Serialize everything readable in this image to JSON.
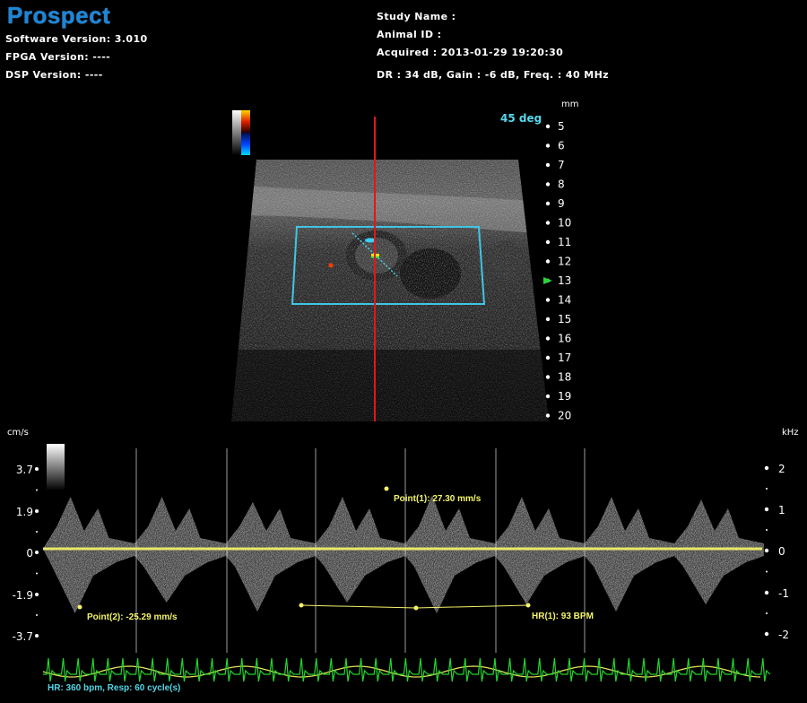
{
  "header": {
    "logo": "Prospect",
    "software_version": "Software Version: 3.010",
    "fpga_version": "FPGA Version: ----",
    "dsp_version": "DSP Version: ----",
    "study_name": "Study Name :",
    "animal_id": "Animal ID :",
    "acquired": "Acquired : 2013-01-29 19:20:30",
    "settings": "DR : 34 dB, Gain : -6 dB, Freq. : 40 MHz"
  },
  "bmode": {
    "angle_label": "45 deg",
    "depth_unit": "mm",
    "depth_ticks": [
      "5",
      "6",
      "7",
      "8",
      "9",
      "10",
      "11",
      "12",
      "13",
      "14",
      "15",
      "16",
      "17",
      "18",
      "19",
      "20"
    ],
    "focus_depth": "13",
    "colors": {
      "cursor_line": "#e01818",
      "roi_box": "#3ec6e6",
      "focus_marker": "#28d23a"
    }
  },
  "doppler": {
    "velocity_unit": "cm/s",
    "velocity_ticks": [
      "3.7",
      "1.9",
      "0",
      "-1.9",
      "-3.7"
    ],
    "freq_unit": "kHz",
    "freq_ticks": [
      "2",
      "1",
      "0",
      "-1",
      "-2"
    ],
    "baseline_color": "#e8e86a",
    "annotations": {
      "point1": "Point(1): 27.30 mm/s",
      "point2": "Point(2): -25.29 mm/s",
      "hr": "HR(1): 93 BPM"
    },
    "physio": "HR: 360 bpm, Resp: 60 cycle(s)",
    "colors": {
      "ecg": "#22d62e",
      "resp": "#e3e35a"
    }
  }
}
